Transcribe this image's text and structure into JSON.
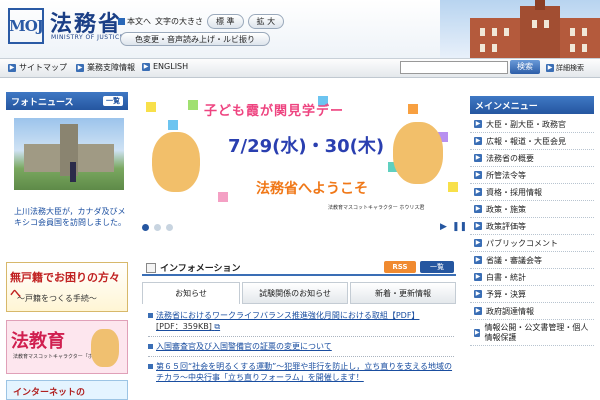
{
  "header": {
    "logo_mark": "MOJ",
    "title": "法務省",
    "subtitle": "MINISTRY OF JUSTICE",
    "skip_link": "本文へ",
    "font_size_label": "文字の大きさ",
    "font_normal": "標 準",
    "font_large": "拡 大",
    "color_change": "色変更・音声読み上げ・ルビ振り"
  },
  "nav": {
    "sitemap": "サイトマップ",
    "business": "業務支障情報",
    "english": "ENGLISH",
    "search_button": "検索",
    "search_placeholder": "",
    "advanced_search": "詳細検索"
  },
  "photo_news": {
    "title": "フォトニュース",
    "list_button": "一覧",
    "caption": "上川法務大臣が，カナダ及びメキシコ会員国を訪問しました。"
  },
  "banners": {
    "koseki_title": "無戸籍でお困りの方々へ",
    "koseki_sub": "～戸籍をつくる手続～",
    "houkyo_title": "法教育",
    "houkyo_sub": "法教育マスコットキャラクター「ホウリス君」",
    "internet": "インターネットの"
  },
  "hero": {
    "line1": "子ども霞が関見学デー",
    "line2": "7/29(水)・30(木)",
    "line3": "法務省へようこそ",
    "credit": "法教育マスコットキャラクター ホウリス君",
    "total_slides": 3,
    "current_slide": 1
  },
  "info": {
    "title": "インフォメーション",
    "rss": "RSS",
    "list_button": "一覧",
    "tabs": [
      "お知らせ",
      "試験関係のお知らせ",
      "新着・更新情報"
    ],
    "items": [
      {
        "text": "法務省におけるワークライフバランス推進強化月間における取組【PDF】",
        "extra": "[PDF：359KB]"
      },
      {
        "text": "入国審査官及び入国警備官の証票の変更について",
        "extra": ""
      },
      {
        "text": "第６５回“社会を明るくする運動”～犯罪や非行を防止し，立ち直りを支える地域のチカラ～中央行事「立ち直りフォーラム」を開催します！",
        "extra": ""
      }
    ]
  },
  "main_menu": {
    "title": "メインメニュー",
    "items": [
      "大臣・副大臣・政務官",
      "広報・報道・大臣会見",
      "法務省の概要",
      "所管法令等",
      "資格・採用情報",
      "政策・施策",
      "政策評価等",
      "パブリックコメント",
      "省議・審議会等",
      "白書・統計",
      "予算・決算",
      "政府調達情報",
      "情報公開・公文書管理・個人情報保護"
    ]
  }
}
